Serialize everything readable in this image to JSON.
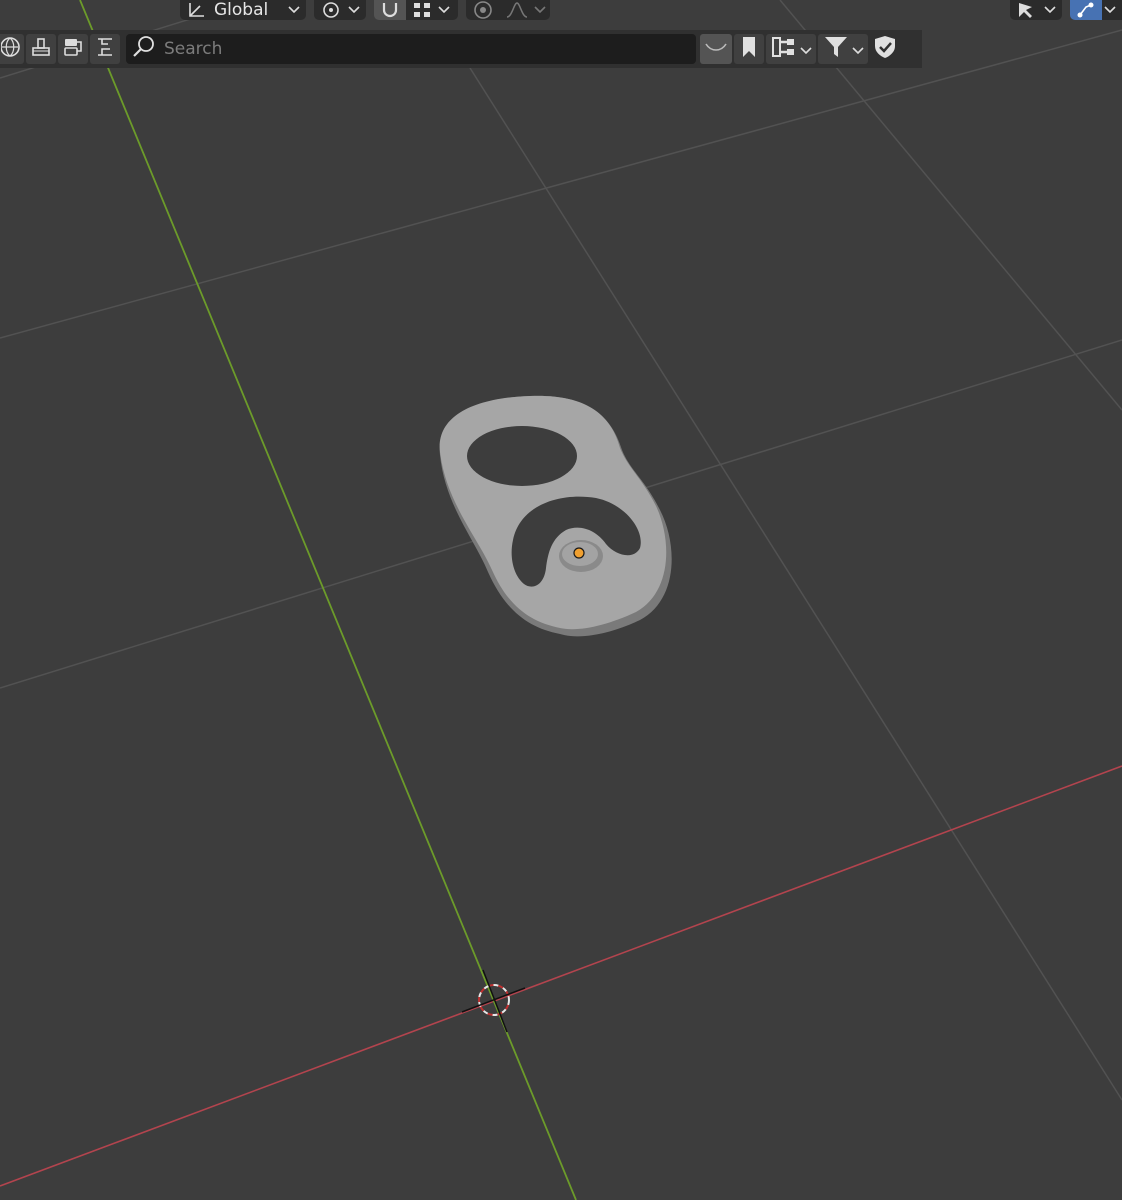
{
  "header": {
    "transform_orientation": {
      "label": "Global",
      "icon": "orientation-icon"
    },
    "pivot": {
      "icon": "pivot-icon"
    },
    "snap": {
      "icon": "magnet-icon",
      "active": true
    },
    "snap_target": {
      "icon": "snap-increment-icon"
    },
    "proportional": {
      "icon": "proportional-edit-icon"
    },
    "falloff": {
      "icon": "falloff-curve-icon"
    },
    "select_tool": {
      "icon": "select-cursor-icon"
    },
    "gizmo_toggle": {
      "icon": "gizmo-icon",
      "active": true
    }
  },
  "outliner_header": {
    "display_modes": [
      "scenes-icon",
      "view-layer-icon",
      "blender-file-icon",
      "orphan-data-icon"
    ],
    "search": {
      "placeholder": "Search"
    },
    "buttons": [
      "hide-icon",
      "bookmark-icon",
      "hierarchy-icon",
      "filter-icon",
      "shield-icon"
    ]
  },
  "colors": {
    "viewport_bg": "#3d3d3d",
    "grid_line": "#525252",
    "x_axis": "#b3444e",
    "y_axis": "#6c9b2a",
    "mesh": "#a6a6a6",
    "origin": "#f0a030",
    "panel": "#303030",
    "field": "#1d1d1d",
    "accent": "#4772b3"
  }
}
